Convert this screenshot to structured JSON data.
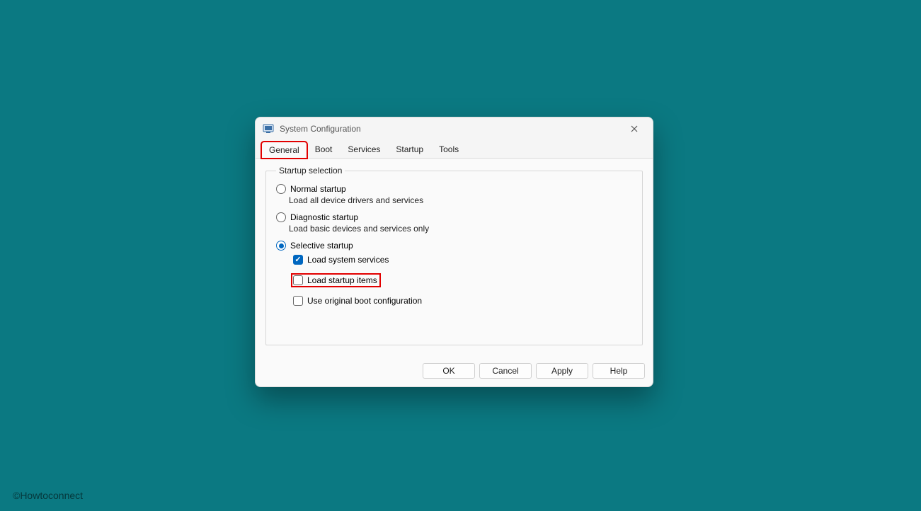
{
  "window": {
    "title": "System Configuration"
  },
  "tabs": {
    "general": "General",
    "boot": "Boot",
    "services": "Services",
    "startup": "Startup",
    "tools": "Tools"
  },
  "group": {
    "legend": "Startup selection",
    "normal": {
      "label": "Normal startup",
      "desc": "Load all device drivers and services"
    },
    "diagnostic": {
      "label": "Diagnostic startup",
      "desc": "Load basic devices and services only"
    },
    "selective": {
      "label": "Selective startup",
      "load_services": "Load system services",
      "load_startup_items": "Load startup items",
      "use_original_boot": "Use original boot configuration"
    }
  },
  "buttons": {
    "ok": "OK",
    "cancel": "Cancel",
    "apply": "Apply",
    "help": "Help"
  },
  "watermark": "©Howtoconnect"
}
